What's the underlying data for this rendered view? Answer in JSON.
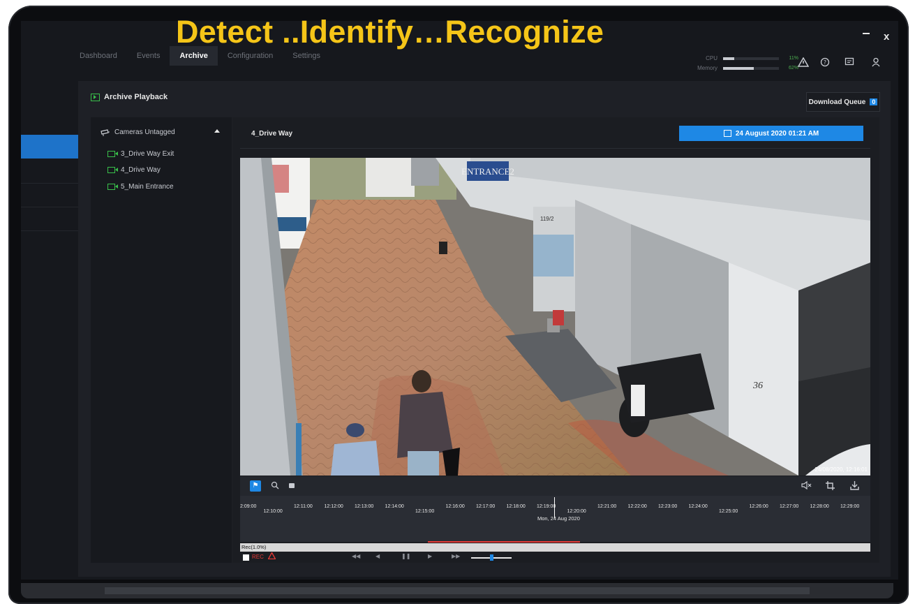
{
  "headline": "Detect ..Identify…Recognize",
  "window": {
    "minimize": "–",
    "close": "x"
  },
  "nav": {
    "tabs": [
      {
        "label": "Dashboard",
        "active": false
      },
      {
        "label": "Events",
        "active": false
      },
      {
        "label": "Archive",
        "active": true
      },
      {
        "label": "Configuration",
        "active": false
      },
      {
        "label": "Settings",
        "active": false
      }
    ]
  },
  "system": {
    "cpu": {
      "label": "CPU",
      "pct_text": "11%",
      "value": 0.2
    },
    "memory": {
      "label": "Memory",
      "pct_text": "62%",
      "value": 0.55
    }
  },
  "header_icons": [
    "warning-icon",
    "help-icon",
    "message-icon",
    "user-icon"
  ],
  "archive": {
    "title": "Archive Playback",
    "download_queue": {
      "label": "Download Queue",
      "count": "0"
    }
  },
  "tree": {
    "group": "Cameras Untagged",
    "cameras": [
      "3_Drive Way Exit",
      "4_Drive Way",
      "5_Main Entrance"
    ]
  },
  "viewer": {
    "camera": "4_Drive Way",
    "date": "24 August 2020 01:21 AM",
    "video_timestamp": "24/08/2020, 12:16:01",
    "video_signs": {
      "entrance": "ENTRANCE2",
      "number": "36",
      "door": "119/2"
    }
  },
  "timeline": {
    "ticks": [
      "2:09:00",
      "12:10:00",
      "12:11:00",
      "12:12:00",
      "12:13:00",
      "12:14:00",
      "12:15:00",
      "12:16:00",
      "12:17:00",
      "12:18:00",
      "12:19:00",
      "12:20:00",
      "12:21:00",
      "12:22:00",
      "12:23:00",
      "12:24:00",
      "12:25:00",
      "12:26:00",
      "12:27:00",
      "12:28:00",
      "12:29:00"
    ],
    "date_label": "Mon, 24 Aug 2020",
    "rec_label": "Rec(1.0%)",
    "rec_status": "REC"
  },
  "colors": {
    "accent": "#1e88e5",
    "headline": "#f5c518",
    "rec": "#e53935",
    "camera_icon": "#39c04a"
  }
}
